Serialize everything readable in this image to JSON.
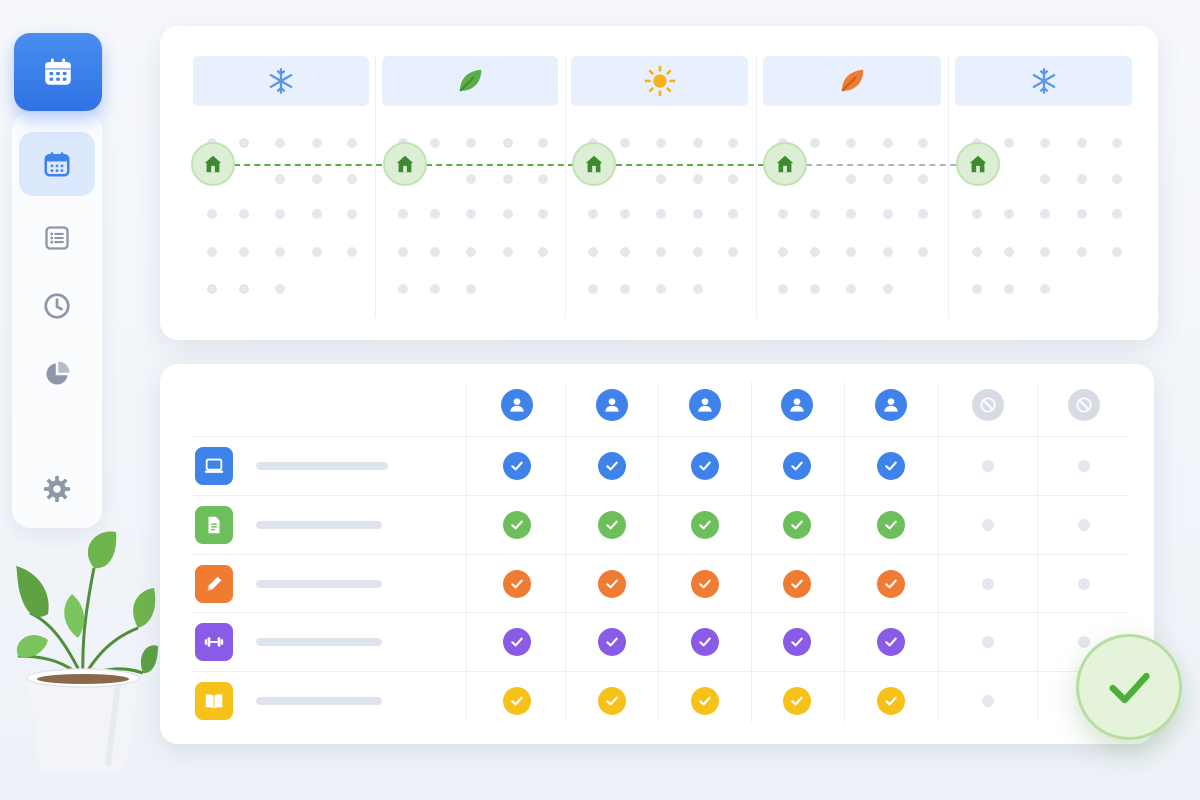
{
  "app": {
    "icon": "calendar-icon"
  },
  "sidebar": {
    "items": [
      {
        "id": "calendar",
        "icon": "calendar-icon",
        "active": true
      },
      {
        "id": "list",
        "icon": "list-icon",
        "active": false
      },
      {
        "id": "history",
        "icon": "clock-icon",
        "active": false
      },
      {
        "id": "reports",
        "icon": "pie-chart-icon",
        "active": false
      },
      {
        "id": "settings",
        "icon": "gear-icon",
        "active": false
      }
    ]
  },
  "timeline": {
    "seasons": [
      {
        "icon": "snowflake-icon",
        "color": "#5b96e8"
      },
      {
        "icon": "leaf-icon",
        "color": "#5aae46"
      },
      {
        "icon": "sun-icon",
        "color": "#f6b21a"
      },
      {
        "icon": "autumn-leaf-icon",
        "color": "#f07b32"
      },
      {
        "icon": "snowflake-icon",
        "color": "#5b96e8"
      }
    ],
    "milestones": [
      {
        "icon": "home-icon"
      },
      {
        "icon": "home-icon"
      },
      {
        "icon": "home-icon"
      },
      {
        "icon": "home-icon"
      },
      {
        "icon": "home-icon"
      }
    ]
  },
  "matrix": {
    "people": [
      {
        "icon": "user-icon",
        "active": true
      },
      {
        "icon": "user-icon",
        "active": true
      },
      {
        "icon": "user-icon",
        "active": true
      },
      {
        "icon": "user-icon",
        "active": true
      },
      {
        "icon": "user-icon",
        "active": true
      },
      {
        "icon": "user-blocked-icon",
        "active": false
      },
      {
        "icon": "user-blocked-icon",
        "active": false
      }
    ],
    "tasks": [
      {
        "icon": "laptop-icon",
        "color": "#3f83ea",
        "checks": [
          true,
          true,
          true,
          true,
          true,
          false,
          false
        ]
      },
      {
        "icon": "document-icon",
        "color": "#6cbf5a",
        "checks": [
          true,
          true,
          true,
          true,
          true,
          false,
          false
        ]
      },
      {
        "icon": "pencil-icon",
        "color": "#f07b32",
        "checks": [
          true,
          true,
          true,
          true,
          true,
          false,
          false
        ]
      },
      {
        "icon": "dumbbell-icon",
        "color": "#8a5ce6",
        "checks": [
          true,
          true,
          true,
          true,
          true,
          false,
          false
        ]
      },
      {
        "icon": "book-icon",
        "color": "#f6c21a",
        "checks": [
          true,
          true,
          true,
          true,
          true,
          false,
          false
        ]
      }
    ]
  },
  "confirm": {
    "icon": "checkmark-icon",
    "color": "#4caf3a"
  }
}
